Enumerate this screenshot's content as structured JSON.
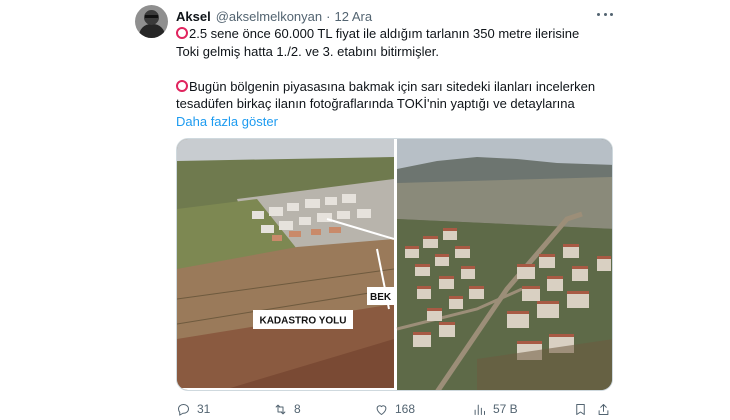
{
  "author": {
    "name": "Aksel",
    "handle": "@akselmelkonyan",
    "separator": "·",
    "date": "12 Ara"
  },
  "tweet": {
    "line1": "2.5 sene önce 60.000 TL fiyat ile aldığım tarlanın 350 metre ilerisine",
    "line2": "Toki gelmiş hatta 1./2. ve 3. etabını bitirmişler.",
    "line3": "Bugün bölgenin piyasasına bakmak için sarı sitedeki ilanları incelerken",
    "line4": "tesadüfen birkaç ilanın fotoğraflarında TOKİ'nin yaptığı ve detaylarına",
    "show_more": "Daha fazla göster",
    "emoji_color": "#e0245e"
  },
  "media": {
    "label_road": "KADASTRO YOLU",
    "label_partial": "BEK"
  },
  "actions": {
    "replies": "31",
    "retweets": "8",
    "likes": "168",
    "views": "57 B"
  },
  "icons": [
    "avatar",
    "more-icon",
    "reply-icon",
    "retweet-icon",
    "like-icon",
    "views-icon",
    "bookmark-icon",
    "share-icon"
  ],
  "colors": {
    "link": "#1d9bf0",
    "secondary_text": "#536471",
    "primary_text": "#0f1419"
  }
}
